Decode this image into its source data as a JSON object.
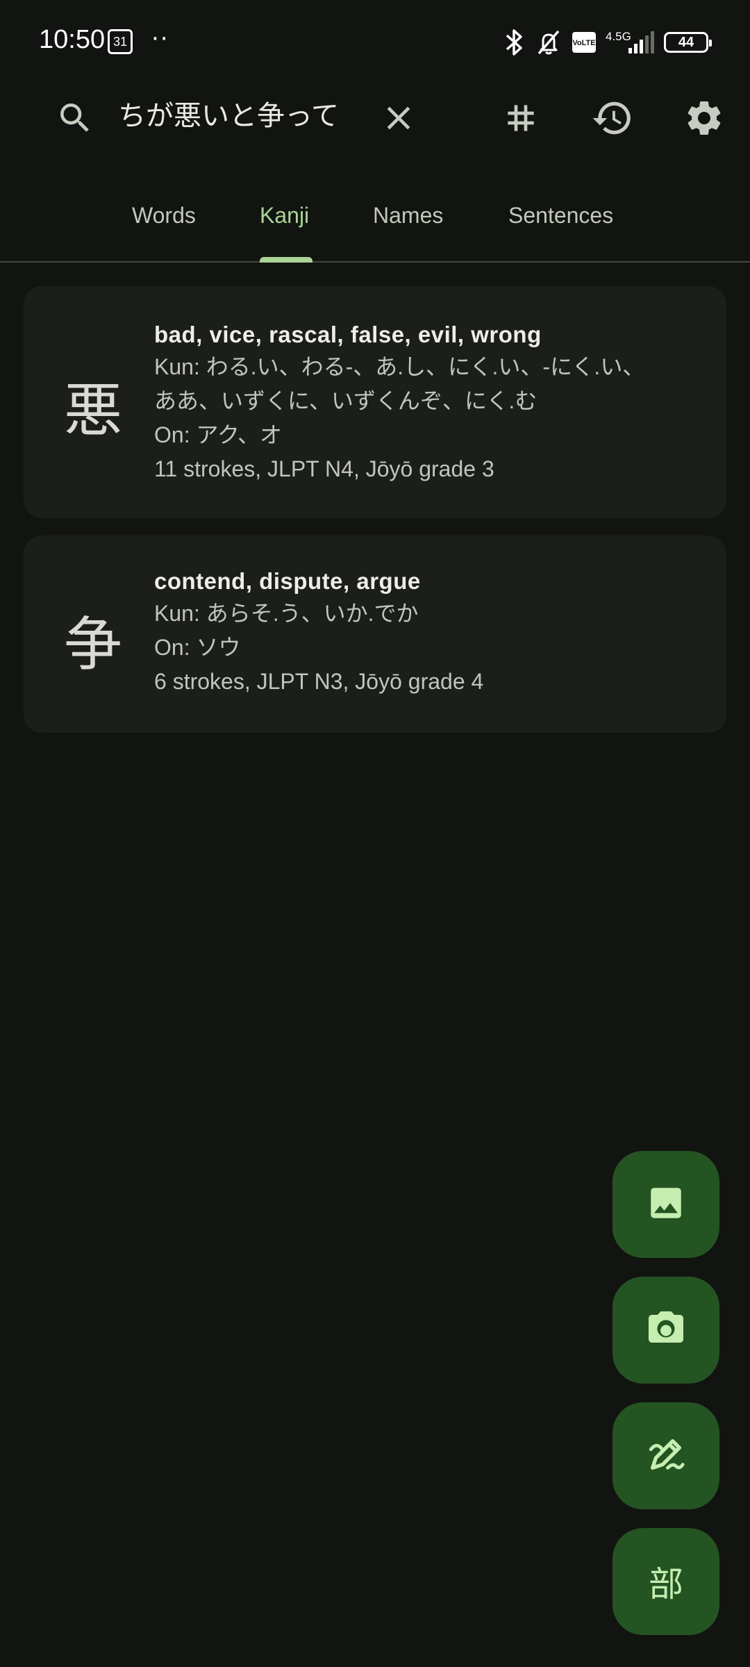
{
  "status_bar": {
    "time": "10:50",
    "calendar_day": "31",
    "dots": "··",
    "volte_line1": "Vo",
    "volte_line2": "LTE",
    "network": "4.5G",
    "battery": "44"
  },
  "toolbar": {
    "search_query": "ちが悪いと争って",
    "icons": [
      "search-icon",
      "clear-icon",
      "hash-icon",
      "history-icon",
      "settings-icon"
    ]
  },
  "tabs": [
    {
      "label": "Words",
      "active": false
    },
    {
      "label": "Kanji",
      "active": true
    },
    {
      "label": "Names",
      "active": false
    },
    {
      "label": "Sentences",
      "active": false
    }
  ],
  "results": [
    {
      "kanji": "悪",
      "meaning": "bad, vice, rascal, false, evil, wrong",
      "kun": "Kun: わる.い、わる-、あ.し、にく.い、-にく.い、",
      "kun_cont": "ああ、いずくに、いずくんぞ、にく.む",
      "on": "On: アク、オ",
      "details": "11 strokes, JLPT N4, Jōyō grade 3"
    },
    {
      "kanji": "争",
      "meaning": "contend, dispute, argue",
      "kun": "Kun: あらそ.う、いか.でか",
      "on": "On: ソウ",
      "details": "6 strokes, JLPT N3, Jōyō grade 4"
    }
  ],
  "fabs": {
    "icons": [
      "image-icon",
      "camera-icon",
      "handwriting-icon"
    ],
    "radical_label": "部"
  },
  "colors": {
    "background": "#121411",
    "card": "#1b1e1a",
    "accent": "#a9d496",
    "fab": "#255423"
  }
}
